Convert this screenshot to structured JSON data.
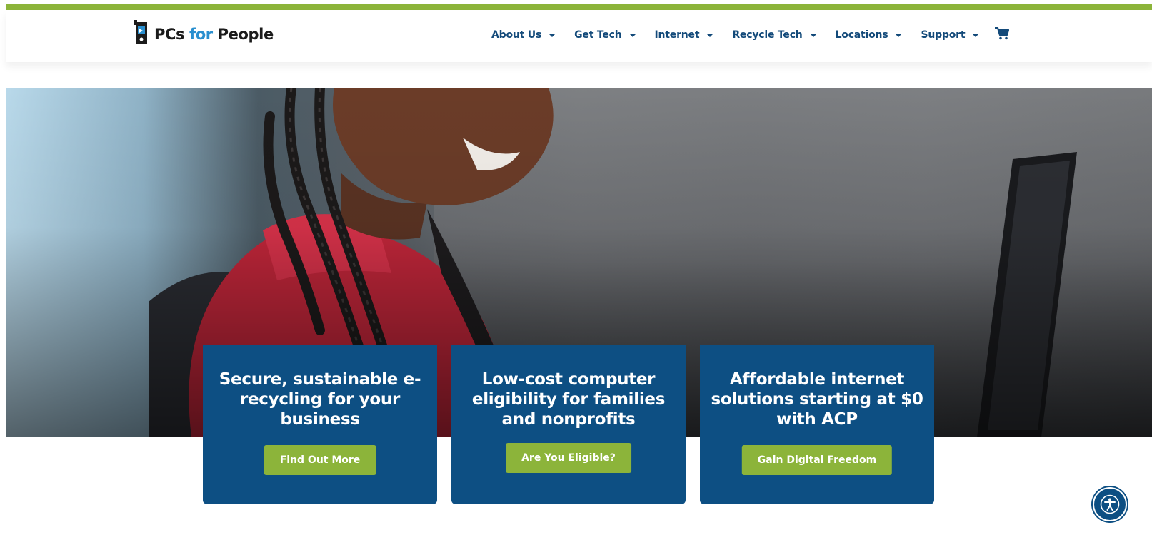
{
  "colors": {
    "accent_green": "#8cb43a",
    "nav_blue": "#134a7a",
    "card_blue": "#0d4f83",
    "logo_for_blue": "#2a8fcf"
  },
  "header": {
    "logo": {
      "text_pre": "PCs ",
      "text_for": "for",
      "text_post": " People",
      "icon": "pc-logo-icon"
    },
    "nav": [
      {
        "label": "About Us",
        "icon": "chevron-down-icon"
      },
      {
        "label": "Get Tech",
        "icon": "chevron-down-icon"
      },
      {
        "label": "Internet",
        "icon": "chevron-down-icon"
      },
      {
        "label": "Recycle Tech",
        "icon": "chevron-down-icon"
      },
      {
        "label": "Locations",
        "icon": "chevron-down-icon"
      },
      {
        "label": "Support",
        "icon": "chevron-down-icon"
      }
    ],
    "cart_icon": "cart-icon"
  },
  "hero": {
    "image_subject": "girl-with-braids-using-laptop"
  },
  "cards": [
    {
      "title": "Secure, sustainable e-recycling for your business",
      "button": "Find Out More"
    },
    {
      "title": "Low-cost computer eligibility for families and nonprofits",
      "button": "Are You Eligible?"
    },
    {
      "title": "Affordable internet solutions starting at $0 with ACP",
      "button": "Gain Digital Freedom"
    }
  ],
  "accessibility_icon": "accessibility-icon"
}
